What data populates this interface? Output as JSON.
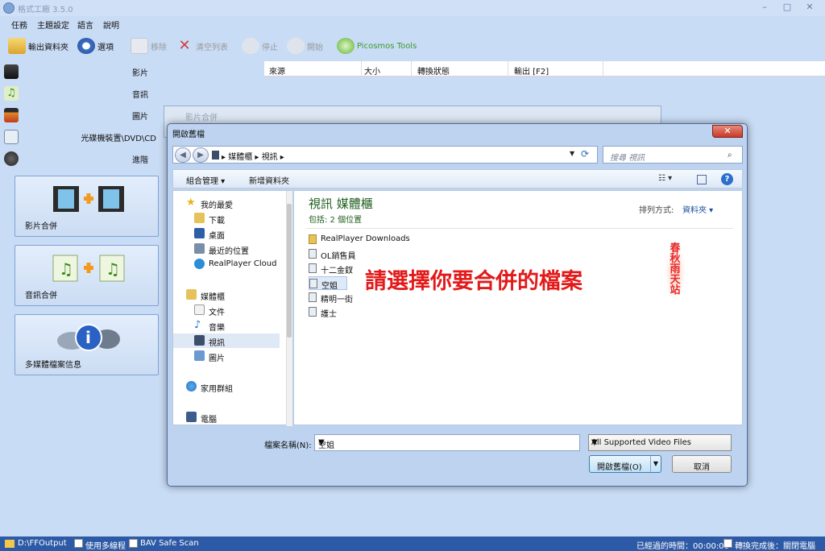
{
  "app": {
    "title": "格式工廠 3.5.0",
    "window_controls": [
      "–",
      "□",
      "✕"
    ],
    "menu": [
      "任務",
      "主題設定",
      "語言",
      "說明"
    ]
  },
  "toolbar": {
    "output_folder": "輸出資料夾",
    "options": "選項",
    "remove": "移除",
    "clear_list": "清空列表",
    "stop": "停止",
    "start": "開始",
    "picosmos": "Picosmos Tools"
  },
  "categories": [
    "影片",
    "音訊",
    "圖片",
    "光碟機裝置\\DVD\\CD",
    "進階"
  ],
  "tools": [
    "影片合併",
    "音訊合併",
    "多媒體檔案信息"
  ],
  "list_header": [
    "來源",
    "大小",
    "轉換狀態",
    "輸出 [F2]"
  ],
  "merge_dialog_title": "影片合併",
  "open_dialog": {
    "title": "開啟舊檔",
    "close": "✕",
    "breadcrumb": "▸  媒體櫃  ▸  視訊  ▸",
    "search_placeholder": "搜尋 視訊",
    "organize": "組合管理 ▾",
    "new_folder": "新增資料夾",
    "nav": {
      "favorites": "我的最愛",
      "downloads": "下載",
      "desktop": "桌面",
      "recent": "最近的位置",
      "realplayer_cloud": "RealPlayer Cloud",
      "libraries": "媒體櫃",
      "documents": "文件",
      "music": "音樂",
      "videos": "視訊",
      "pictures": "圖片",
      "homegroup": "家用群組",
      "computer": "電腦"
    },
    "library_title": "視訊 媒體櫃",
    "library_subtitle": "包括: 2 個位置",
    "sort_label": "排列方式:",
    "sort_value": "資料夾 ▾",
    "files": [
      "RealPlayer Downloads",
      "OL銷售員",
      "十二金釵",
      "空姐",
      "精明一街",
      "護士"
    ],
    "overlay_text": "請選擇你要合併的檔案",
    "stamp_text": "春秋雨天站",
    "filename_label": "檔案名稱(N):",
    "filename_value": "空姐",
    "filetype_value": "All Supported Video Files",
    "open_button": "開啟舊檔(O)",
    "cancel_button": "取消"
  },
  "status": {
    "output_path": "D:\\FFOutput",
    "use_multithread": "使用多線程",
    "bav_safe_scan": "BAV Safe Scan",
    "elapsed": "已經過的時間：00:00:00",
    "after_convert": "轉換完成後：關閉電腦"
  }
}
